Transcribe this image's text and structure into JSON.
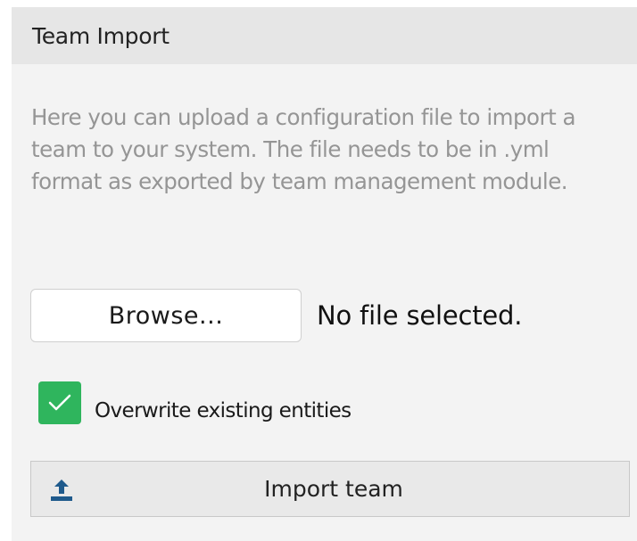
{
  "widget": {
    "title": "Team Import",
    "description": "Here you can upload a configuration file to import a team to your system. The file needs to be in .yml format as exported by team management module."
  },
  "file_input": {
    "browse_label": "Browse...",
    "status": "No file selected."
  },
  "overwrite_option": {
    "label": "Overwrite existing entities",
    "checked": true,
    "check_color": "#2fb55d"
  },
  "import_button": {
    "label": "Import team",
    "icon": "upload-icon",
    "icon_color": "#1f5a8c"
  }
}
